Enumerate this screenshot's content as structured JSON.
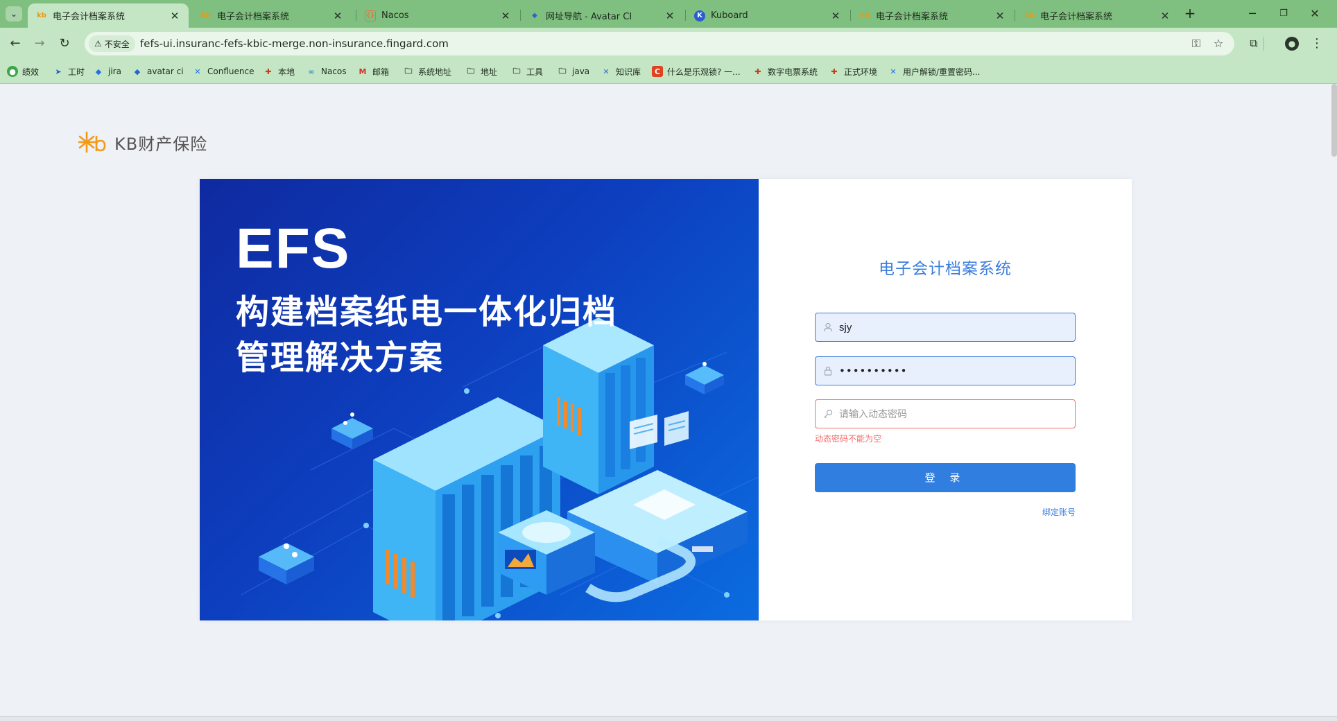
{
  "browser": {
    "tabs": [
      {
        "title": "电子会计档案系统",
        "active": true
      },
      {
        "title": "电子会计档案系统",
        "active": false
      },
      {
        "title": "Nacos",
        "active": false
      },
      {
        "title": "网址导航 - Avatar CI",
        "active": false
      },
      {
        "title": "Kuboard",
        "active": false
      },
      {
        "title": "电子会计档案系统",
        "active": false
      },
      {
        "title": "电子会计档案系统",
        "active": false
      }
    ],
    "security_label": "不安全",
    "url": "fefs-ui.insuranc-fefs-kbic-merge.non-insurance.fingard.com",
    "bookmarks": [
      "绩效",
      "工时",
      "jira",
      "avatar ci",
      "Confluence",
      "本地",
      "Nacos",
      "邮箱",
      "系统地址",
      "地址",
      "工具",
      "java",
      "知识库",
      "什么是乐观锁? 一...",
      "数字电票系统",
      "正式环境",
      "用户解锁/重置密码..."
    ]
  },
  "logo": {
    "text": "KB财产保险"
  },
  "banner": {
    "title": "EFS",
    "line1": "构建档案纸电一体化归档",
    "line2": "管理解决方案"
  },
  "login": {
    "system_title": "电子会计档案系统",
    "username_value": "sjy",
    "password_value": "••••••••••",
    "otp_placeholder": "请输入动态密码",
    "otp_error": "动态密码不能为空",
    "submit_label": "登 录",
    "bind_account_link": "绑定账号"
  },
  "colors": {
    "accent": "#2f7ee0",
    "error": "#f56c6c",
    "chrome_green": "#7fbf7f"
  }
}
